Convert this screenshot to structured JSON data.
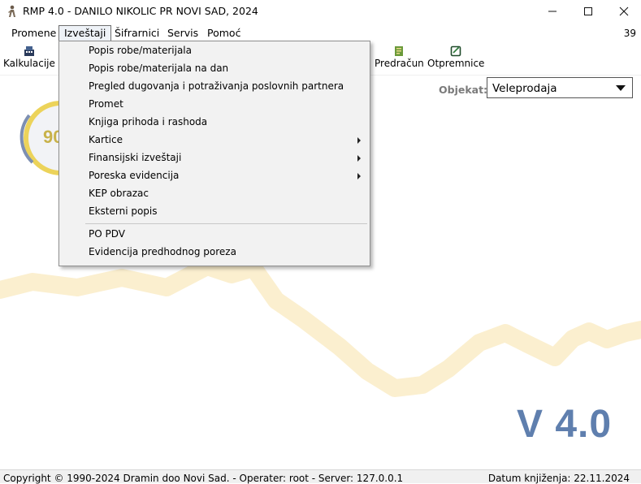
{
  "window": {
    "title": "RMP 4.0 - DANILO NIKOLIC PR NOVI SAD, 2024",
    "icon": "app-figure-icon",
    "controls": [
      "minimize-icon",
      "maximize-icon",
      "close-icon"
    ]
  },
  "menubar": {
    "items": [
      "Promene",
      "Izveštaji",
      "Šifrarnici",
      "Servis",
      "Pomoć"
    ],
    "active": "Izveštaji",
    "counter": "39"
  },
  "toolbar": {
    "items": [
      {
        "label": "Kalkulacije",
        "icon": "calculator-icon"
      },
      {
        "label": "Predračun",
        "icon": "invoice-icon"
      },
      {
        "label": "Otpremnice",
        "icon": "delivery-note-icon"
      }
    ]
  },
  "objekat": {
    "label": "Objekat:",
    "selected": "Veleprodaja"
  },
  "dropdown": {
    "items": [
      {
        "label": "Popis robe/materijala",
        "submenu": false
      },
      {
        "label": "Popis robe/materijala na dan",
        "submenu": false
      },
      {
        "label": "Pregled dugovanja i potraživanja poslovnih partnera",
        "submenu": false
      },
      {
        "label": "Promet",
        "submenu": false
      },
      {
        "label": "Knjiga prihoda i rashoda",
        "submenu": false
      },
      {
        "label": "Kartice",
        "submenu": true
      },
      {
        "label": "Finansijski izveštaji",
        "submenu": true
      },
      {
        "label": "Poreska evidencija",
        "submenu": true
      },
      {
        "label": "KEP obrazac",
        "submenu": false
      },
      {
        "label": "Eksterni popis",
        "submenu": false
      },
      {
        "label": "PO PDV",
        "submenu": false
      },
      {
        "label": "Evidencija predhodnog poreza",
        "submenu": false
      }
    ]
  },
  "background": {
    "version": "V 4.0",
    "logo_text": "90",
    "accent": "#fbe9b8",
    "version_color": "#5f7fae"
  },
  "statusbar": {
    "left": "Copyright © 1990-2024 Dramin doo Novi Sad. - Operater: root - Server: 127.0.0.1",
    "right": "Datum knjiženja: 22.11.2024"
  }
}
